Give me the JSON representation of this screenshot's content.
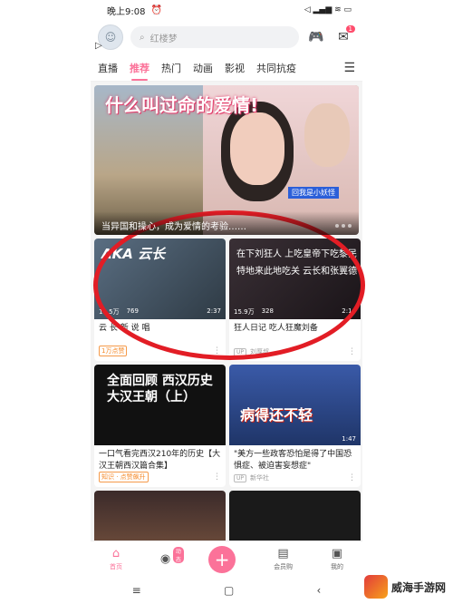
{
  "status_bar": {
    "time": "晚上9:08",
    "alarm": "⏰",
    "icons_right": "◁ ▂▄▆ ≋ ▭"
  },
  "header": {
    "search_placeholder": "红楼梦",
    "message_badge": "1"
  },
  "tabs": [
    {
      "label": "直播",
      "active": false
    },
    {
      "label": "推荐",
      "active": true
    },
    {
      "label": "热门",
      "active": false
    },
    {
      "label": "动画",
      "active": false
    },
    {
      "label": "影视",
      "active": false
    },
    {
      "label": "共同抗疫",
      "active": false
    }
  ],
  "banner": {
    "overlay_title": "什么叫过命的爱情!",
    "tag": "回我是小妖怪",
    "caption": "当异国和操心，成为爱情的考验……"
  },
  "cards": [
    {
      "thumb_text": "AKA 云长",
      "thumb_bg": "#3a4a5a",
      "plays": "11.5万",
      "danmaku": "769",
      "duration": "2:37",
      "title": "云 长 新 说 唱",
      "meta_pill": "1万点赞",
      "uploader": ""
    },
    {
      "thumb_text": "在下刘狂人 上吃皇帝下吃黎民 特地来此地吃关 云长和张翼德",
      "thumb_bg": "#2a2228",
      "plays": "15.9万",
      "danmaku": "328",
      "duration": "2:14",
      "title": "狂人日记 吃人狂魔刘备",
      "meta_pill": "",
      "uploader": "刘厚叔"
    },
    {
      "thumb_text": "全面回顾 西汉历史 大汉王朝（上）",
      "thumb_bg": "#111111",
      "plays": "",
      "danmaku": "",
      "duration": "",
      "title": "一口气看完西汉210年的历史【大汉王朝西汉篇合集】",
      "meta_pill": "知识 · 点赞飙升",
      "uploader": ""
    },
    {
      "thumb_text": "病得还不轻",
      "thumb_bg": "#2d4a8c",
      "plays": "",
      "danmaku": "",
      "duration": "1:47",
      "title": "\"美方一些政客恐怕是得了中国恐惧症、被迫害妄想症\"",
      "meta_pill": "",
      "uploader": "新华社"
    }
  ],
  "bottom_nav": [
    {
      "label": "首页",
      "icon": "home-icon",
      "active": true
    },
    {
      "label": "",
      "icon": "activity-icon",
      "badge": "动态",
      "active": false
    },
    {
      "label": "",
      "icon": "plus-icon",
      "active": false
    },
    {
      "label": "会员购",
      "icon": "shop-icon",
      "active": false
    },
    {
      "label": "我的",
      "icon": "tv-icon",
      "active": false
    }
  ],
  "system_bar": [
    "≡",
    "▢",
    "‹"
  ],
  "watermark": "威海手游网",
  "colors": {
    "accent": "#fb7299",
    "ring": "#e21d25"
  }
}
